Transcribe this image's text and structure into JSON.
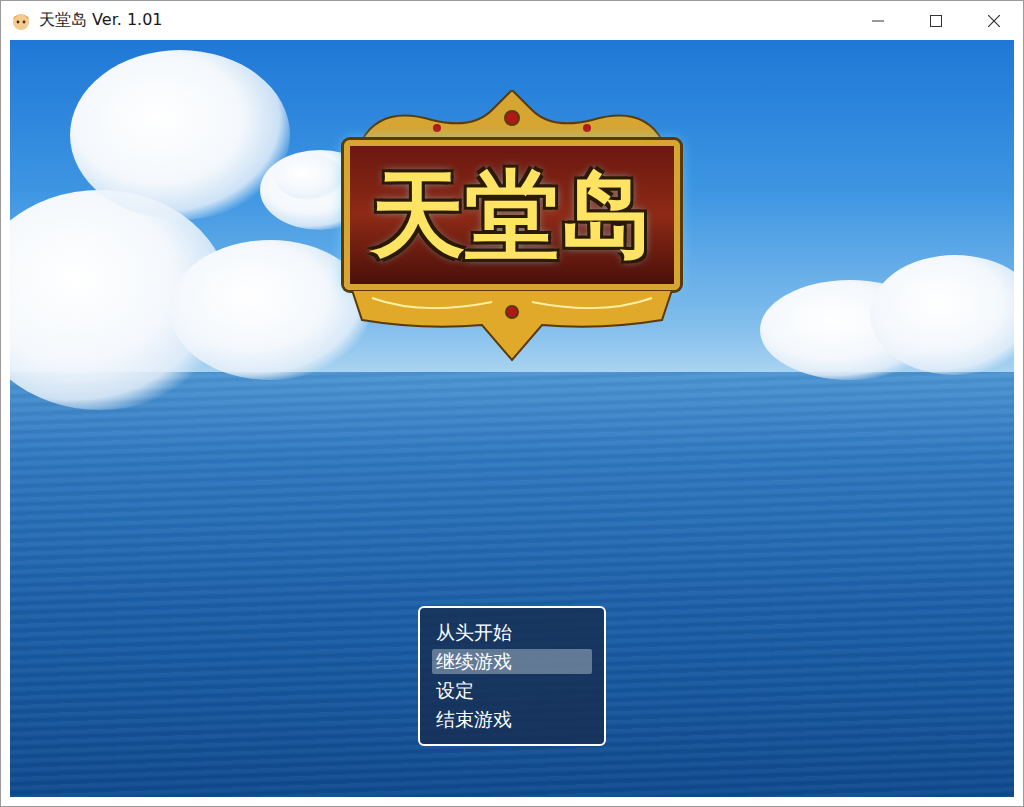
{
  "window": {
    "title": "天堂岛 Ver. 1.01"
  },
  "logo": {
    "text": "天堂岛"
  },
  "menu": {
    "items": [
      {
        "label": "从头开始",
        "selected": false
      },
      {
        "label": "继续游戏",
        "selected": true
      },
      {
        "label": "设定",
        "selected": false
      },
      {
        "label": "结束游戏",
        "selected": false
      }
    ]
  }
}
